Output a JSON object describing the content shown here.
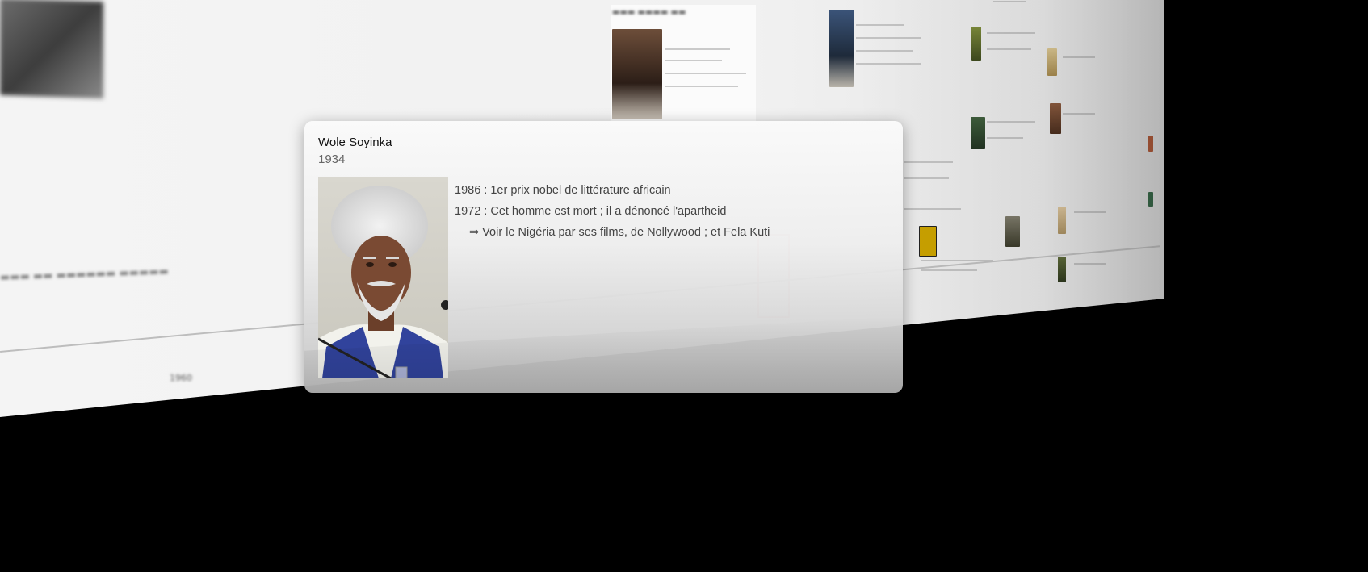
{
  "popup": {
    "title": "Wole Soyinka",
    "date": "1934",
    "portrait_icon": "person-portrait-icon",
    "events": [
      "1986 : 1er prix nobel de littérature africain",
      "1972 : Cet homme est mort ; il a dénoncé l'apartheid"
    ],
    "link_line": "⇒ Voir le Nigéria par ses films, de Nollywood ; et Fela Kuti"
  },
  "background": {
    "axis_label": "1960"
  },
  "colors": {
    "background": "#000000",
    "popup_title": "#111111",
    "popup_text": "#444444",
    "popup_date": "#666666"
  }
}
